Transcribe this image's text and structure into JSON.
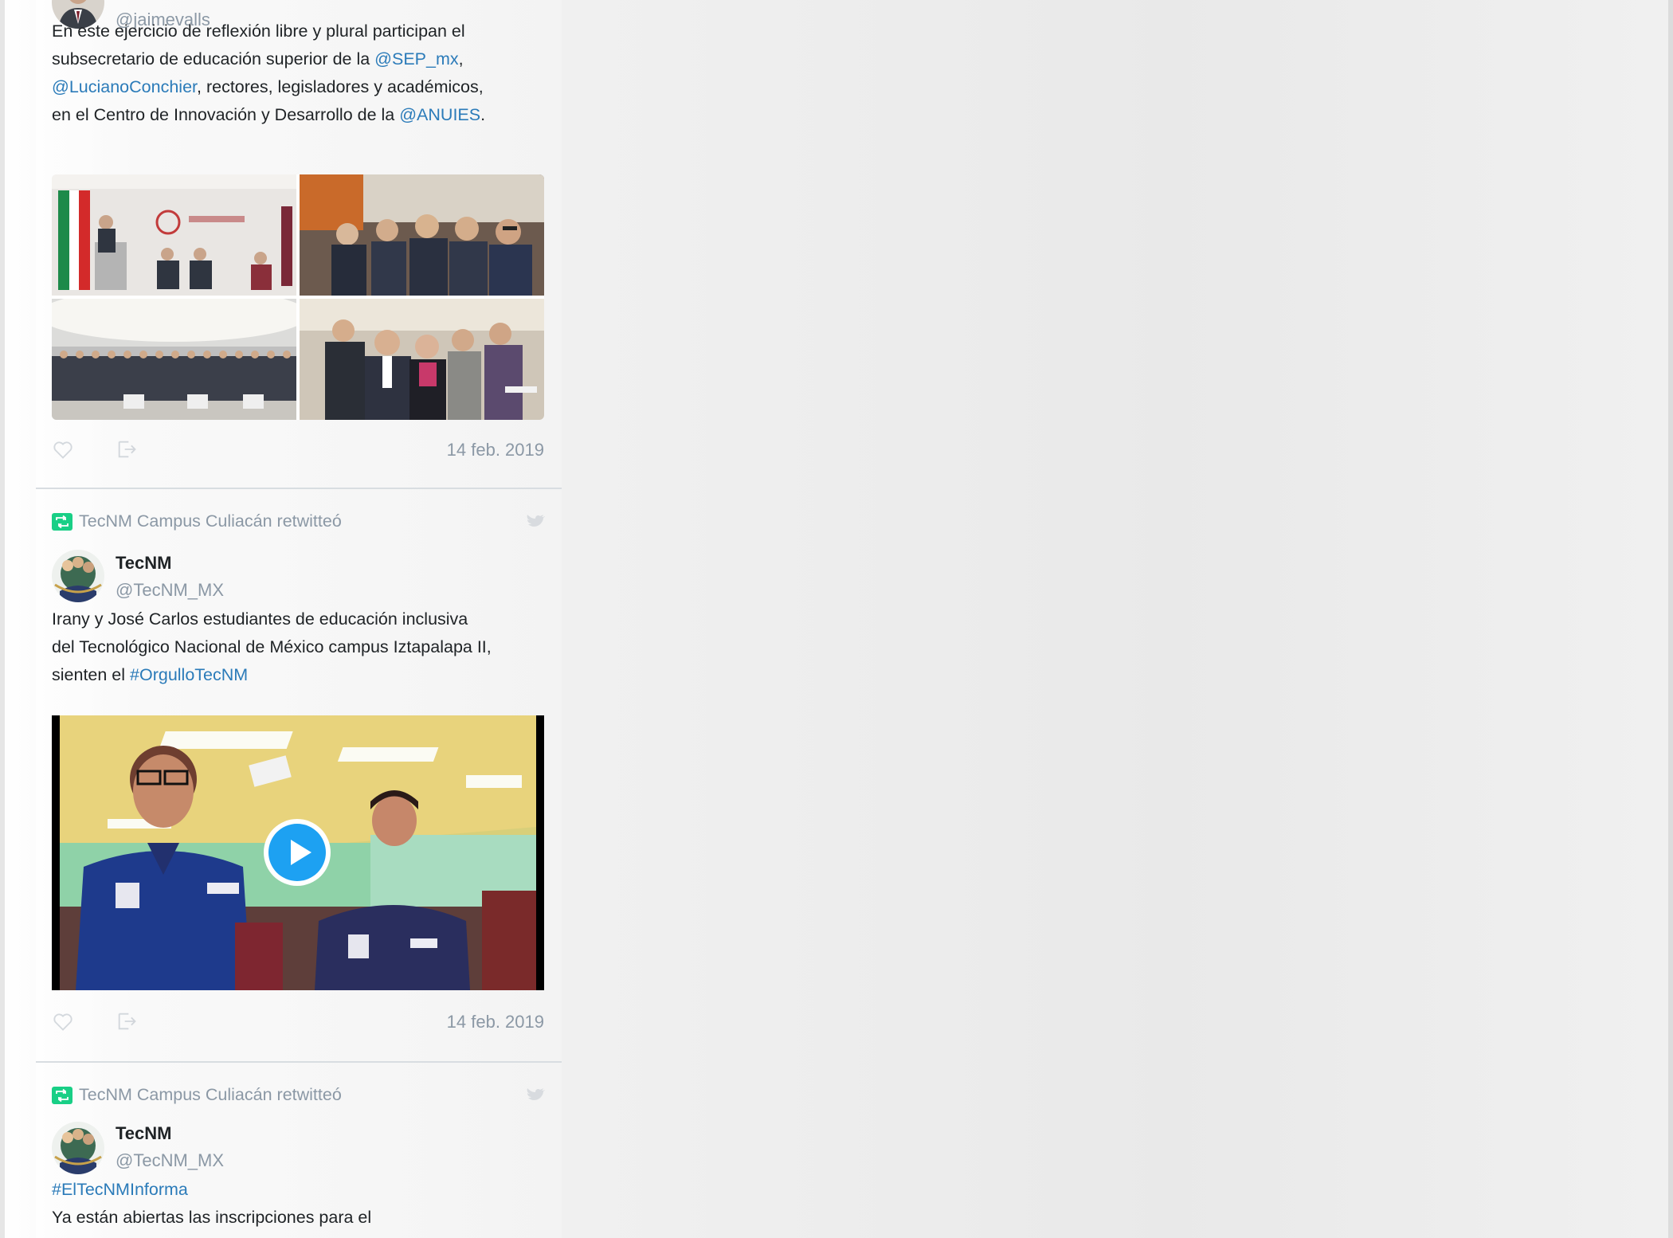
{
  "tweets": [
    {
      "author_handle": "@jaimevalls",
      "text_lines": [
        "En este ejercicio de reflexión libre y plural participan el",
        "subsecretario de educación superior de la ",
        "@SEP_mx",
        ",",
        "@LucianoConchier",
        ", rectores, legisladores y académicos,",
        "en el Centro de Innovación y Desarrollo de la ",
        "@ANUIES",
        "."
      ],
      "date": "14 feb. 2019"
    },
    {
      "retweeted_by": "TecNM Campus Culiacán retwitteó",
      "author_name": "TecNM",
      "author_handle": "@TecNM_MX",
      "text_lines": [
        "Irany y José Carlos estudiantes de educación inclusiva",
        "del Tecnológico Nacional de México campus Iztapalapa II,",
        "sienten el ",
        "#OrgulloTecNM"
      ],
      "date": "14 feb. 2019"
    },
    {
      "retweeted_by": "TecNM Campus Culiacán retwitteó",
      "author_name": "TecNM",
      "author_handle": "@TecNM_MX",
      "text_lines": [
        "#ElTecNMInforma",
        "Ya están abiertas las inscripciones para el"
      ]
    }
  ],
  "colors": {
    "link": "#2b7bb9",
    "muted": "#8b98a5",
    "retweet_green": "#19cf86",
    "text": "#1f2326"
  }
}
